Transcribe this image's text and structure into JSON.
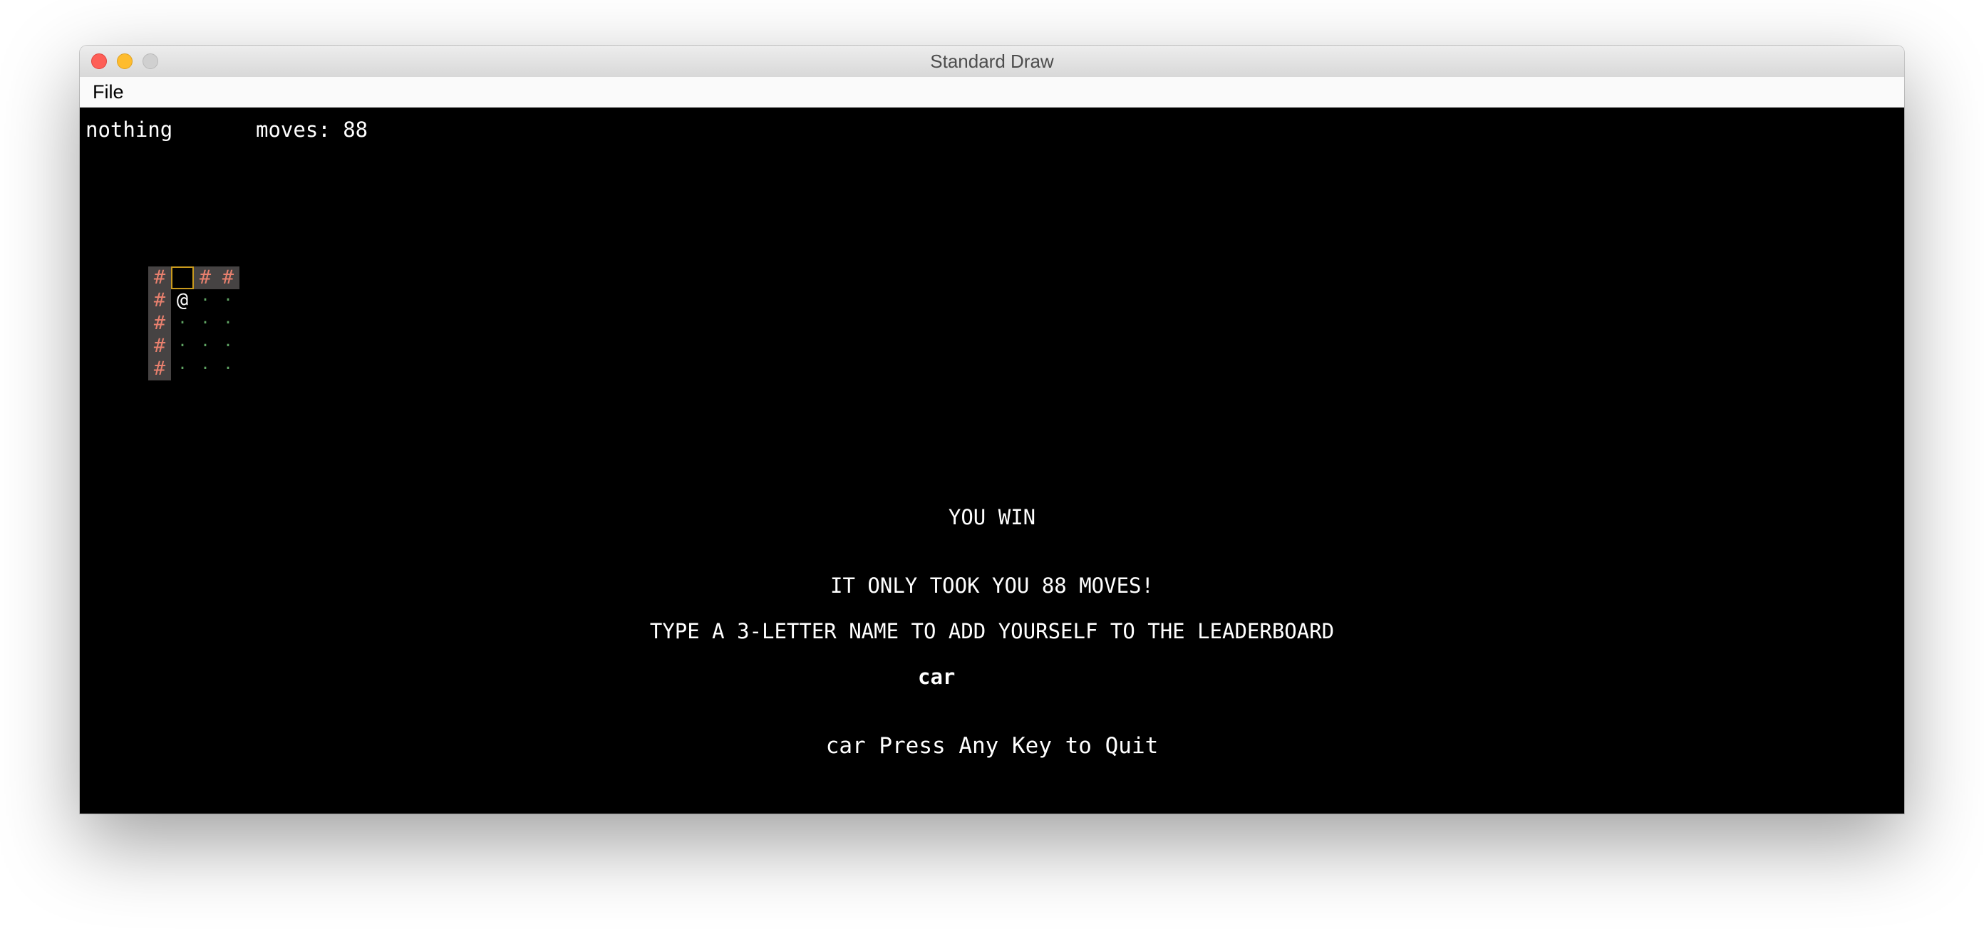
{
  "window": {
    "title": "Standard Draw"
  },
  "menu": {
    "file_label": "File"
  },
  "hud": {
    "tile_label": "nothing",
    "moves_label": "moves: 88"
  },
  "map": {
    "rows": [
      [
        "#",
        "",
        "#",
        "#"
      ],
      [
        "#",
        "@",
        "·",
        "·"
      ],
      [
        "#",
        "·",
        "·",
        "·"
      ],
      [
        "#",
        "·",
        "·",
        "·"
      ],
      [
        "#",
        "·",
        "·",
        "·"
      ]
    ]
  },
  "messages": {
    "win": "YOU WIN",
    "took": "IT ONLY TOOK YOU 88 MOVES!",
    "prompt": "TYPE A 3-LETTER NAME TO ADD YOURSELF TO THE LEADERBOARD",
    "typed_name": "car",
    "quit": "car Press Any Key to Quit"
  },
  "colors": {
    "background": "#000000",
    "wall_glyph": "#e8806e",
    "wall_fill": "#464343",
    "floor_glyph": "#5fa463",
    "door_outline": "#c99a1d",
    "text": "#ffffff"
  }
}
